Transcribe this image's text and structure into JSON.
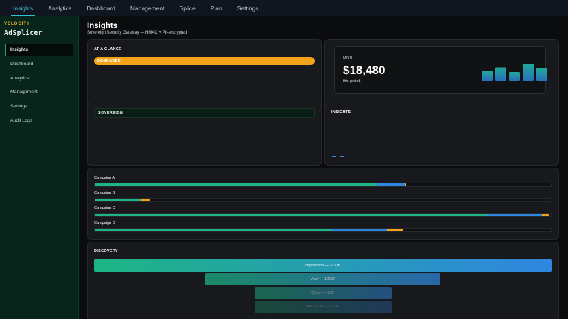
{
  "topnav": {
    "tabs": [
      {
        "label": "Insights",
        "active": true
      },
      {
        "label": "Analytics",
        "active": false
      },
      {
        "label": "Dashboard",
        "active": false
      },
      {
        "label": "Management",
        "active": false
      },
      {
        "label": "Splice",
        "active": false
      },
      {
        "label": "Plan",
        "active": false
      },
      {
        "label": "Settings",
        "active": false
      }
    ]
  },
  "sidebar": {
    "brand_top": "VELOCITY",
    "brand_name": "AdSplicer",
    "items": [
      {
        "label": "Insights",
        "active": true
      },
      {
        "label": "Dashboard",
        "active": false
      },
      {
        "label": "Analytics",
        "active": false
      },
      {
        "label": "Management",
        "active": false
      },
      {
        "label": "Settings",
        "active": false
      },
      {
        "label": "Audit Logs",
        "active": false
      }
    ]
  },
  "page": {
    "title": "Insights",
    "subtitle": "Sovereign Security Gateway — HMAC + PII-encrypted"
  },
  "glance": {
    "label": "AT A GLANCE",
    "status": "DEGRADED"
  },
  "kpi": {
    "label": "MRR",
    "value": "$18,480",
    "period": "this period",
    "spark": [
      0.55,
      0.75,
      0.5,
      0.95,
      0.7
    ]
  },
  "sovereign": {
    "label": "SOVEREIGN"
  },
  "insights_card": {
    "label": "INSIGHTS"
  },
  "campaigns": [
    {
      "name": "Campaign A",
      "segments": [
        0.62,
        0.06,
        0.002
      ]
    },
    {
      "name": "Campaign B",
      "segments": [
        0.1,
        0.0,
        0.022
      ]
    },
    {
      "name": "Campaign C",
      "segments": [
        0.86,
        0.12,
        0.017
      ]
    },
    {
      "name": "Campaign D",
      "segments": [
        0.52,
        0.12,
        0.035
      ]
    }
  ],
  "discovery": {
    "title": "DISCOVERY",
    "funnel": [
      {
        "label": "Impression — 32376",
        "value": 32376
      },
      {
        "label": "View — 12507",
        "value": 12507
      },
      {
        "label": "Click — 4532",
        "value": 4532
      },
      {
        "label": "AddToCart — 1795",
        "value": 1795
      }
    ]
  },
  "colors": {
    "accent_teal": "#2ec4cf",
    "green": "#1db584",
    "blue": "#2f86e0",
    "orange": "#f5a319"
  }
}
